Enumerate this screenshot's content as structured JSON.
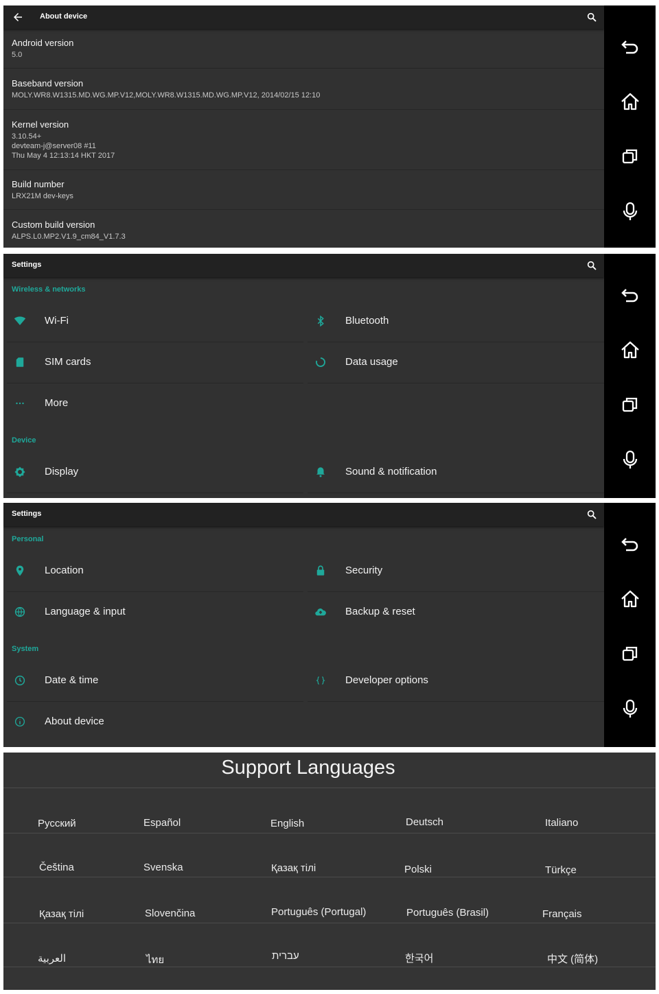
{
  "colors": {
    "accent": "#1fa89a",
    "background": "#313131",
    "topbar": "#222222",
    "navbar": "#000000"
  },
  "nav_icons": [
    "back-icon",
    "home-icon",
    "recent-apps-icon",
    "microphone-icon"
  ],
  "about": {
    "title": "About device",
    "items": [
      {
        "title": "Android version",
        "sub": "5.0"
      },
      {
        "title": "Baseband version",
        "sub": "MOLY.WR8.W1315.MD.WG.MP.V12,MOLY.WR8.W1315.MD.WG.MP.V12, 2014/02/15 12:10"
      },
      {
        "title": "Kernel version",
        "sub": "3.10.54+\ndevteam-j@server08 #11\nThu May 4 12:13:14 HKT 2017"
      },
      {
        "title": "Build number",
        "sub": "LRX21M dev-keys"
      },
      {
        "title": "Custom build version",
        "sub": "ALPS.L0.MP2.V1.9_cm84_V1.7.3"
      }
    ]
  },
  "settings1": {
    "title": "Settings",
    "section_wireless": "Wireless & networks",
    "section_device": "Device",
    "items": {
      "wifi": "Wi-Fi",
      "bluetooth": "Bluetooth",
      "sim": "SIM cards",
      "data": "Data usage",
      "more": "More",
      "display": "Display",
      "sound": "Sound & notification"
    }
  },
  "settings2": {
    "title": "Settings",
    "section_personal": "Personal",
    "section_system": "System",
    "items": {
      "location": "Location",
      "security": "Security",
      "language": "Language & input",
      "backup": "Backup & reset",
      "date": "Date & time",
      "developer": "Developer options",
      "about": "About device"
    }
  },
  "languages": {
    "title": "Support Languages",
    "rows": [
      [
        "Русский",
        "Español",
        "English",
        "Deutsch",
        "Italiano"
      ],
      [
        "Čeština",
        "Svenska",
        "Қазақ тілі",
        "Polski",
        "Türkçe"
      ],
      [
        "Қазақ тілі",
        "Slovenčina",
        "Português (Portugal)",
        "Português (Brasil)",
        "Français"
      ],
      [
        "العربية",
        "ไทย",
        "עברית",
        "한국어",
        "中文 (简体)"
      ]
    ]
  }
}
